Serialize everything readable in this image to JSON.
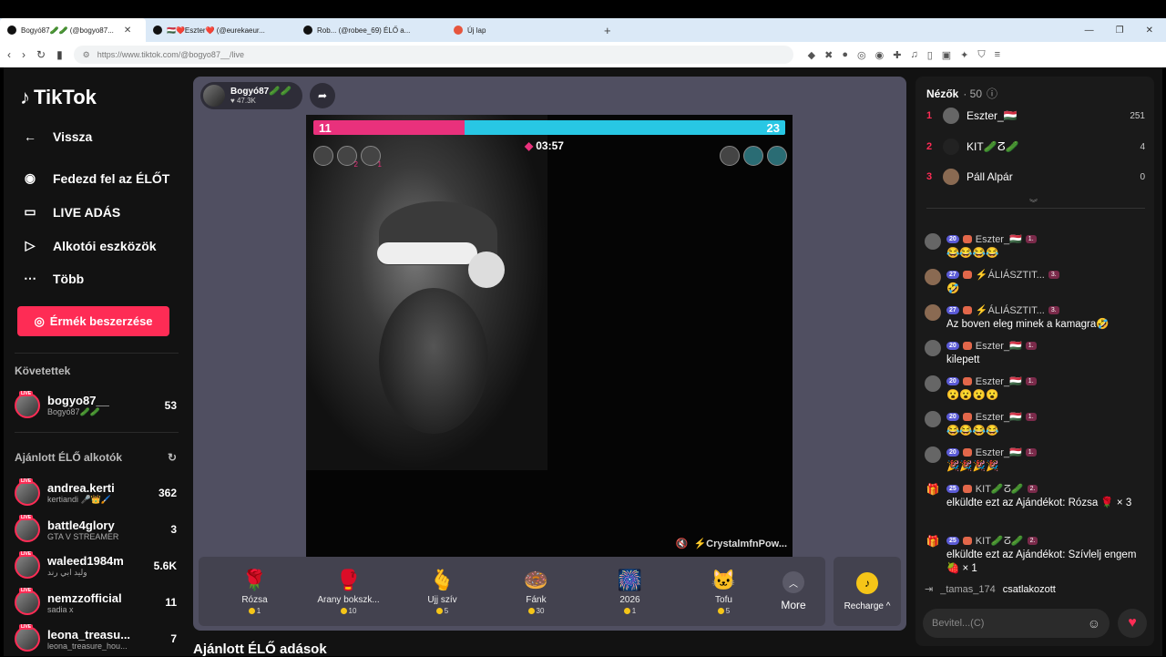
{
  "browser": {
    "tabs": [
      {
        "label": "Bogyó87🥒🥒 (@bogyo87...",
        "active": true
      },
      {
        "label": "🇭🇺❤️Eszter❤️ (@eurekaeur...",
        "active": false
      },
      {
        "label": "Rob... (@robee_69) ÉLŐ a...",
        "active": false
      },
      {
        "label": "Új lap",
        "active": false
      }
    ],
    "url": "https://www.tiktok.com/@bogyo87__/live"
  },
  "sidebar": {
    "logo": "TikTok",
    "nav": [
      {
        "label": "Vissza",
        "icon": "back-arrow-icon"
      },
      {
        "label": "Fedezd fel az ÉLŐT",
        "icon": "explore-avatar-icon"
      },
      {
        "label": "LIVE ADÁS",
        "icon": "camera-icon"
      },
      {
        "label": "Alkotói eszközök",
        "icon": "creator-tools-icon"
      },
      {
        "label": "Több",
        "icon": "more-dots-icon"
      }
    ],
    "coin_button": "Érmék beszerzése",
    "following_title": "Követettek",
    "following": [
      {
        "name": "bogyo87__",
        "sub": "Bogyó87🥒🥒",
        "count": "53"
      }
    ],
    "recommended_title": "Ajánlott ÉLŐ alkotók",
    "recommended": [
      {
        "name": "andrea.kerti",
        "sub": "kertiandi 🎤👑🖌️",
        "count": "362"
      },
      {
        "name": "battle4glory",
        "sub": "GTA V STREAMER",
        "count": "3"
      },
      {
        "name": "waleed1984m",
        "sub": "وليد ابي رند",
        "count": "5.6K"
      },
      {
        "name": "nemzzofficial",
        "sub": "sadia x",
        "count": "11"
      },
      {
        "name": "leona_treasu...",
        "sub": "leona_treasure_hou...",
        "count": "7"
      }
    ]
  },
  "stream": {
    "host_name": "Bogyó87🥒🥒",
    "host_likes": "47.3K",
    "score_left": "11",
    "score_right": "23",
    "left_fraction": 0.32,
    "timer": "03:57",
    "left_avatar_counts": [
      "2",
      "1"
    ],
    "opponent_label": "⚡CrystalmfnPow...",
    "gifts": [
      {
        "name": "Rózsa",
        "price": "1",
        "icon": "🌹"
      },
      {
        "name": "Arany bokszk...",
        "price": "10",
        "icon": "🥊"
      },
      {
        "name": "Ujj szív",
        "price": "5",
        "icon": "🫰"
      },
      {
        "name": "Fánk",
        "price": "30",
        "icon": "🍩"
      },
      {
        "name": "2026",
        "price": "1",
        "icon": "🎆"
      },
      {
        "name": "Tofu",
        "price": "5",
        "icon": "🐱"
      }
    ],
    "more_label": "More",
    "recharge_label": "Recharge ^",
    "below_title": "Ajánlott ÉLŐ adások"
  },
  "chat": {
    "viewers_label": "Nézők",
    "viewers_count": "· 50",
    "ranking": [
      {
        "rank": "1",
        "name": "Eszter_🇭🇺",
        "score": "251"
      },
      {
        "rank": "2",
        "name": "KIT🥒ⵒ🥒",
        "score": "4"
      },
      {
        "rank": "3",
        "name": "Páll Alpár",
        "score": "0"
      }
    ],
    "messages": [
      {
        "level": "20",
        "user": "Eszter_🇭🇺",
        "team": "1.",
        "text": "😂😂😂😂"
      },
      {
        "level": "27",
        "user": "⚡ÁLIÁSZTIT...",
        "team": "3.",
        "text": "🤣"
      },
      {
        "level": "27",
        "user": "⚡ÁLIÁSZTIT...",
        "team": "3.",
        "text": "Az boven eleg minek a kamagra🤣"
      },
      {
        "level": "20",
        "user": "Eszter_🇭🇺",
        "team": "1.",
        "text": "kilepett"
      },
      {
        "level": "20",
        "user": "Eszter_🇭🇺",
        "team": "1.",
        "text": "😮😮😮😮"
      },
      {
        "level": "20",
        "user": "Eszter_🇭🇺",
        "team": "1.",
        "text": "😂😂😂😂"
      },
      {
        "level": "20",
        "user": "Eszter_🇭🇺",
        "team": "1.",
        "text": "🎉🎉🎉🎉"
      },
      {
        "level": "25",
        "user": "KIT🥒ⵒ🥒",
        "team": "2.",
        "text": "elküldte ezt az Ajándékot: Rózsa 🌹 × 3"
      },
      {
        "level": "25",
        "user": "KIT🥒ⵒ🥒",
        "team": "2.",
        "text": "elküldte ezt az Ajándékot: Szívlelj engem 🍓 × 1"
      }
    ],
    "joined_user": "_tamas_174",
    "joined_text": "csatlakozott",
    "input_placeholder": "Bevitel...(C)"
  }
}
